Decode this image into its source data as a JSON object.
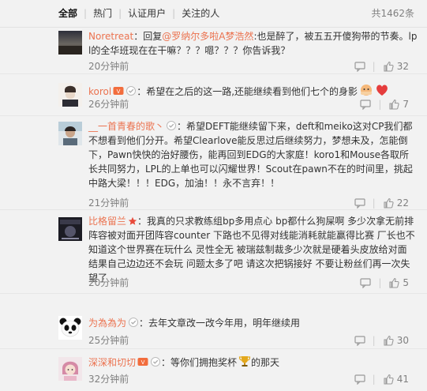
{
  "filter": {
    "tabs": [
      "全部",
      "热门",
      "认证用户",
      "关注的人"
    ],
    "total": "共1462条"
  },
  "comments": [
    {
      "username": "Noretreat",
      "colon": "：",
      "segments": [
        {
          "text": "回复",
          "type": "text"
        },
        {
          "text": "@罗纳尔多啦A梦浩然",
          "type": "mention"
        },
        {
          "text": ":也是醉了，被五五开傻狗带的节奏。lpl的全华班现在在干嘛？？？嗯？？？你告诉我？",
          "type": "text"
        }
      ],
      "time": "20分钟前",
      "likes": "32"
    },
    {
      "username": "korol",
      "colon": "：",
      "segments": [
        {
          "text": "希望在之后的这一路,还能继续看到他们七个的身影",
          "type": "text"
        }
      ],
      "time": "26分钟前",
      "likes": "7"
    },
    {
      "username": "__一首青春的歌丶",
      "colon": "：",
      "segments": [
        {
          "text": "希望DEFT能继续留下来，deft和meiko这对CP我们都不想看到他们分开。希望Clearlove能反思过后继续努力，梦想未及，怎能倒下，Pawn快快的治好腰伤，能再回到EDG的大家庭！koro1和Mouse各取所长共同努力，LPL的上单也可以闪耀世界！Scout在pawn不在的时间里，挑起中路大梁！！！EDG，加油！！永不言弃！！",
          "type": "text"
        }
      ],
      "time": "21分钟前",
      "likes": "22"
    },
    {
      "username": "比格留兰",
      "colon": "：",
      "segments": [
        {
          "text": "我真的只求教练组bp多用点心 bp都什么狗屎啊 多少次拿无前排阵容被对面开团阵容counter 下路也不见得对线能消耗就能赢得比赛 厂长也不知道这个世界赛在玩什么 灵性全无 被瑞兹制裁多少次就是硬着头皮放给对面 结果自己边边还不会玩 问题太多了吧 请这次把锅接好 不要让粉丝们再一次失望了",
          "type": "text"
        }
      ],
      "time": "20分钟前",
      "likes": "5"
    },
    {
      "username": "为為為为",
      "colon": "：",
      "segments": [
        {
          "text": "去年文章改一改今年用，明年继续用",
          "type": "text"
        }
      ],
      "time": "25分钟前",
      "likes": "30"
    },
    {
      "username": "深深和切切",
      "colon": "：",
      "segments": [
        {
          "text": "等你们拥抱奖杯",
          "type": "text"
        },
        {
          "text": "的那天",
          "type": "text"
        }
      ],
      "time": "32分钟前",
      "likes": "41"
    }
  ],
  "icons": {
    "like": "thumbs-up-icon",
    "reply": "comment-icon",
    "share": "share-icon"
  },
  "colors": {
    "username": "#eb7350",
    "meta": "#808080",
    "background": "#f2f2f2"
  }
}
